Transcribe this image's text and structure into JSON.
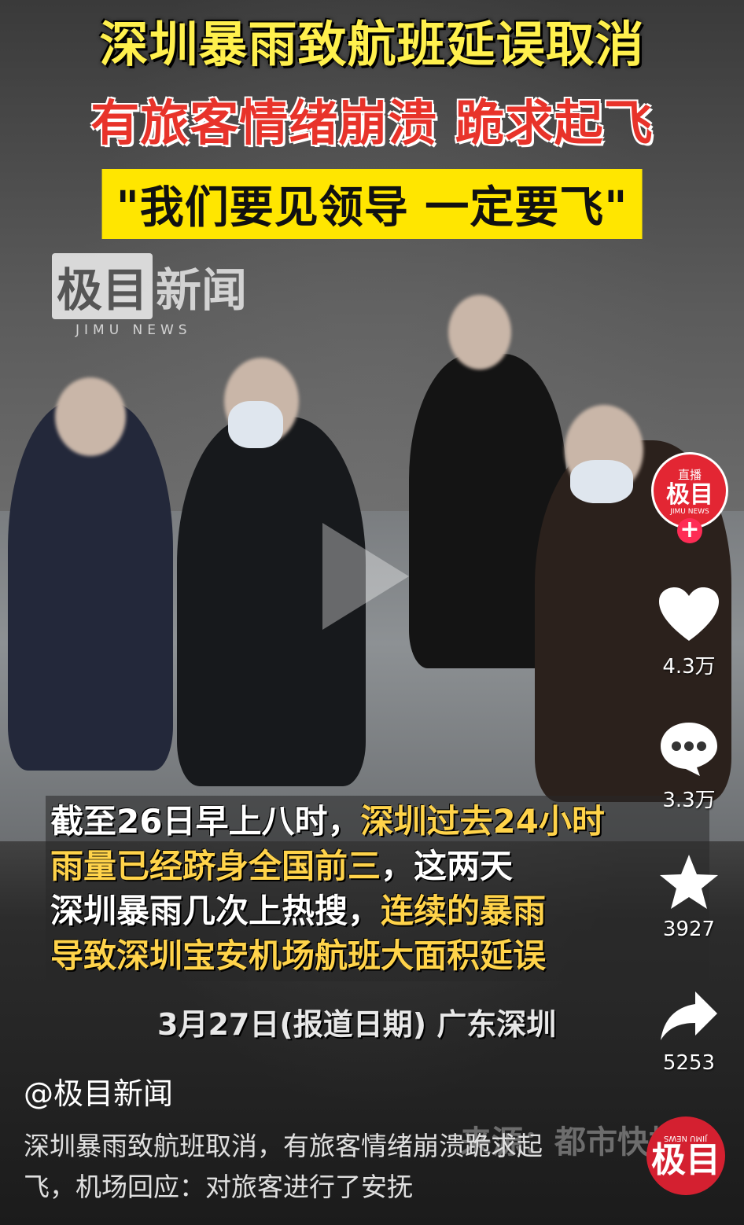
{
  "headline": {
    "line1": "深圳暴雨致航班延误取消",
    "line2": "有旅客情绪崩溃 跪求起飞",
    "line3": "\"我们要见领导 一定要飞\""
  },
  "watermark": {
    "box_text": "极目",
    "text": "新闻",
    "sub": "JIMU NEWS"
  },
  "subtitle": {
    "line1_white": "截至26日早上八时，",
    "line1_yellow": "深圳过去24小时",
    "line2_yellow": "雨量已经跻身全国前三",
    "line2_white": "，这两天",
    "line3_white": "深圳暴雨几次上热搜，",
    "line3_yellow": "连续的暴雨",
    "line4_yellow": "导致深圳宝安机场航班大面积延误"
  },
  "dateline": "3月27日(报道日期) 广东深圳",
  "source": "来源：都市快报",
  "author": "@极目新闻",
  "description": "深圳暴雨致航班取消，有旅客情绪崩溃跪求起飞，机场回应：对旅客进行了安抚",
  "sidebar": {
    "avatar": {
      "live_label": "直播",
      "name": "极目",
      "en": "JIMU NEWS",
      "follow": "+"
    },
    "like_count": "4.3万",
    "comment_count": "3.3万",
    "favorite_count": "3927",
    "share_count": "5253"
  },
  "logo_badge": {
    "big": "极目",
    "tiny": "JIMU NEWS"
  },
  "colors": {
    "headline_yellow": "#fff04d",
    "headline_red": "#e8332a",
    "accent_red": "#fe2c55"
  }
}
